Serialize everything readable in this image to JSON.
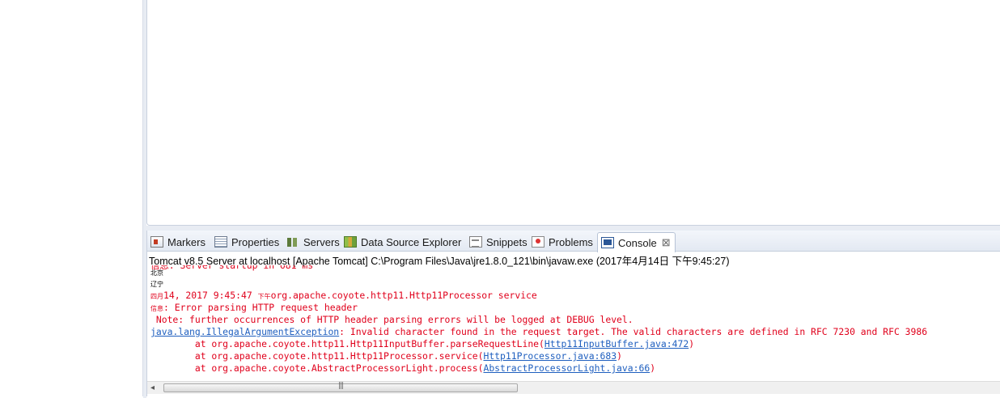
{
  "tabs": [
    {
      "label": "Markers",
      "icon": "markers-icon"
    },
    {
      "label": "Properties",
      "icon": "properties-icon"
    },
    {
      "label": "Servers",
      "icon": "servers-icon"
    },
    {
      "label": "Data Source Explorer",
      "icon": "data-source-explorer-icon"
    },
    {
      "label": "Snippets",
      "icon": "snippets-icon"
    },
    {
      "label": "Problems",
      "icon": "problems-icon"
    },
    {
      "label": "Console",
      "icon": "console-icon",
      "active": true,
      "close": "⊠"
    }
  ],
  "console": {
    "title": "Tomcat v8.5 Server at localhost [Apache Tomcat] C:\\Program Files\\Java\\jre1.8.0_121\\bin\\javaw.exe (2017年4月14日 下午9:45:27)",
    "clipped_line": "信息: Server startup in 681 ms",
    "lines": {
      "l1": "北京",
      "l2": "辽宁",
      "l3_prefix": "四月",
      "l3_text": "14, 2017 9:45:47 ",
      "l3_ampm": "下午",
      "l3_rest": "org.apache.coyote.http11.Http11Processor service",
      "l4_prefix": "信息",
      "l4_text": ": Error parsing HTTP request header",
      "l5": " Note: further occurrences of HTTP header parsing errors will be logged at DEBUG level.",
      "l6_link": "java.lang.IllegalArgumentException",
      "l6_text": ": Invalid character found in the request target. The valid characters are defined in RFC 7230 and RFC 3986",
      "l7_text": "        at org.apache.coyote.http11.Http11InputBuffer.parseRequestLine(",
      "l7_link": "Http11InputBuffer.java:472",
      "l8_text": "        at org.apache.coyote.http11.Http11Processor.service(",
      "l8_link": "Http11Processor.java:683",
      "l9_text": "        at org.apache.coyote.AbstractProcessorLight.process(",
      "l9_link": "AbstractProcessorLight.java:66",
      "close_paren": ")"
    }
  },
  "scrollbar": {
    "left_arrow": "◂",
    "grip": "|||"
  },
  "colors": {
    "error": "#e0001b",
    "link": "#1f5fbf",
    "tab_bg": "#e3e9f2"
  }
}
